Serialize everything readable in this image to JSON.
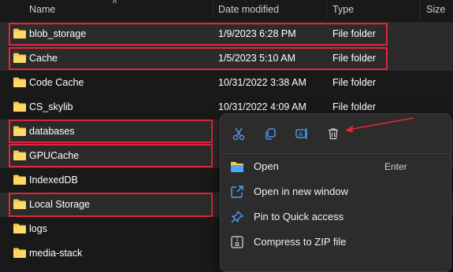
{
  "columns": {
    "name": "Name",
    "date_modified": "Date modified",
    "type": "Type",
    "size": "Size"
  },
  "rows": [
    {
      "name": "blob_storage",
      "date": "1/9/2023 6:28 PM",
      "type": "File folder"
    },
    {
      "name": "Cache",
      "date": "1/5/2023 5:10 AM",
      "type": "File folder"
    },
    {
      "name": "Code Cache",
      "date": "10/31/2022 3:38 AM",
      "type": "File folder"
    },
    {
      "name": "CS_skylib",
      "date": "10/31/2022 4:09 AM",
      "type": "File folder"
    },
    {
      "name": "databases",
      "date": "",
      "type": ""
    },
    {
      "name": "GPUCache",
      "date": "",
      "type": ""
    },
    {
      "name": "IndexedDB",
      "date": "",
      "type": ""
    },
    {
      "name": "Local Storage",
      "date": "",
      "type": ""
    },
    {
      "name": "logs",
      "date": "",
      "type": ""
    },
    {
      "name": "media-stack",
      "date": "",
      "type": ""
    }
  ],
  "context_menu": {
    "quick_actions": [
      "cut-icon",
      "copy-icon",
      "rename-icon",
      "delete-icon"
    ],
    "items": [
      {
        "label": "Open",
        "shortcut": "Enter",
        "icon": "open-folder-icon"
      },
      {
        "label": "Open in new window",
        "shortcut": "",
        "icon": "new-window-icon"
      },
      {
        "label": "Pin to Quick access",
        "shortcut": "",
        "icon": "pin-icon"
      },
      {
        "label": "Compress to ZIP file",
        "shortcut": "",
        "icon": "zip-icon"
      }
    ]
  },
  "colors": {
    "highlight": "#e0263a",
    "folder": "#f2c94c",
    "accent": "#4da3ff"
  }
}
